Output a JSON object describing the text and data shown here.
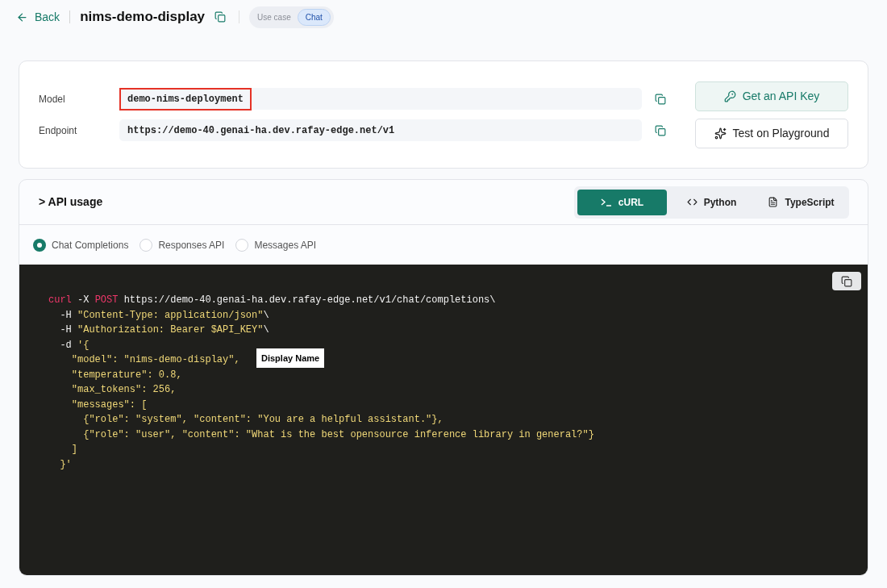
{
  "header": {
    "back": "Back",
    "title": "nims-demo-display",
    "use_case": {
      "label": "Use case",
      "value": "Chat"
    }
  },
  "details": {
    "fields": [
      {
        "label": "Model",
        "value": "demo-nims-deployment",
        "highlighted": true
      },
      {
        "label": "Endpoint",
        "value": "https://demo-40.genai-ha.dev.rafay-edge.net/v1",
        "highlighted": false
      }
    ],
    "actions": [
      {
        "label": "Get an API Key",
        "kind": "key"
      },
      {
        "label": "Test on Playground",
        "kind": "sparkle"
      }
    ]
  },
  "api_usage": {
    "title": "> API usage",
    "tabs": [
      {
        "label": "cURL",
        "kind": "terminal",
        "selected": true
      },
      {
        "label": "Python",
        "kind": "code",
        "selected": false
      },
      {
        "label": "TypeScript",
        "kind": "file",
        "selected": false
      }
    ],
    "options": [
      {
        "label": "Chat Completions",
        "selected": true
      },
      {
        "label": "Responses API",
        "selected": false
      },
      {
        "label": "Messages API",
        "selected": false
      }
    ],
    "code": [
      [
        {
          "kind": "keyword",
          "text": "curl"
        },
        {
          "kind": "plain",
          "text": " -X "
        },
        {
          "kind": "keyword",
          "text": "POST"
        },
        {
          "kind": "plain",
          "text": " https://demo-40.genai-ha.dev.rafay-edge.net/v1/chat/completions\\"
        }
      ],
      [
        {
          "kind": "plain",
          "text": "  -H "
        },
        {
          "kind": "string",
          "text": "\"Content-Type: application/json\""
        },
        {
          "kind": "plain",
          "text": "\\"
        }
      ],
      [
        {
          "kind": "plain",
          "text": "  -H "
        },
        {
          "kind": "string",
          "text": "\"Authorization: Bearer $API_KEY\""
        },
        {
          "kind": "plain",
          "text": "\\"
        }
      ],
      [
        {
          "kind": "plain",
          "text": "  -d "
        },
        {
          "kind": "string",
          "text": "'{"
        }
      ],
      [
        {
          "kind": "string",
          "text": "    \"model\": \"nims-demo-display\","
        }
      ],
      [
        {
          "kind": "string",
          "text": "    \"temperature\": 0.8,"
        }
      ],
      [
        {
          "kind": "string",
          "text": "    \"max_tokens\": 256,"
        }
      ],
      [
        {
          "kind": "string",
          "text": "    \"messages\": ["
        }
      ],
      [
        {
          "kind": "string",
          "text": "      {\"role\": \"system\", \"content\": \"You are a helpful assistant.\"},"
        }
      ],
      [
        {
          "kind": "string",
          "text": "      {\"role\": \"user\", \"content\": \"What is the best opensource inference library in general?\"}"
        }
      ],
      [
        {
          "kind": "string",
          "text": "    ]"
        }
      ],
      [
        {
          "kind": "string",
          "text": "  }'"
        }
      ]
    ],
    "callout": "Display Name"
  }
}
